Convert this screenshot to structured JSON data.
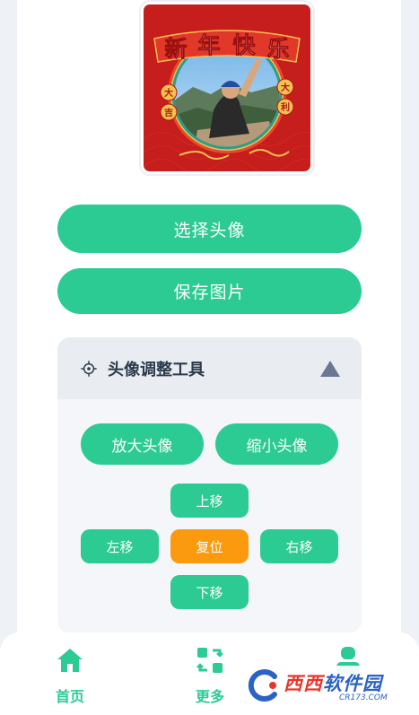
{
  "avatar": {
    "banner_text": "新年快乐",
    "left_scroll": "大吉",
    "right_scroll": "大利"
  },
  "actions": {
    "select_avatar": "选择头像",
    "save_image": "保存图片"
  },
  "tools_panel": {
    "title": "头像调整工具",
    "zoom_in": "放大头像",
    "zoom_out": "缩小头像",
    "move_up": "上移",
    "move_left": "左移",
    "reset": "复位",
    "move_right": "右移",
    "move_down": "下移"
  },
  "tabbar": {
    "home": "首页",
    "more": "更多"
  },
  "watermark": {
    "brand_red": "西西",
    "brand_blue": "软件园",
    "domain": "CR173.COM"
  },
  "colors": {
    "primary": "#2ccb93",
    "reset": "#fb9a0e",
    "frame_red": "#c41e1e",
    "gold": "#f2c14e"
  }
}
